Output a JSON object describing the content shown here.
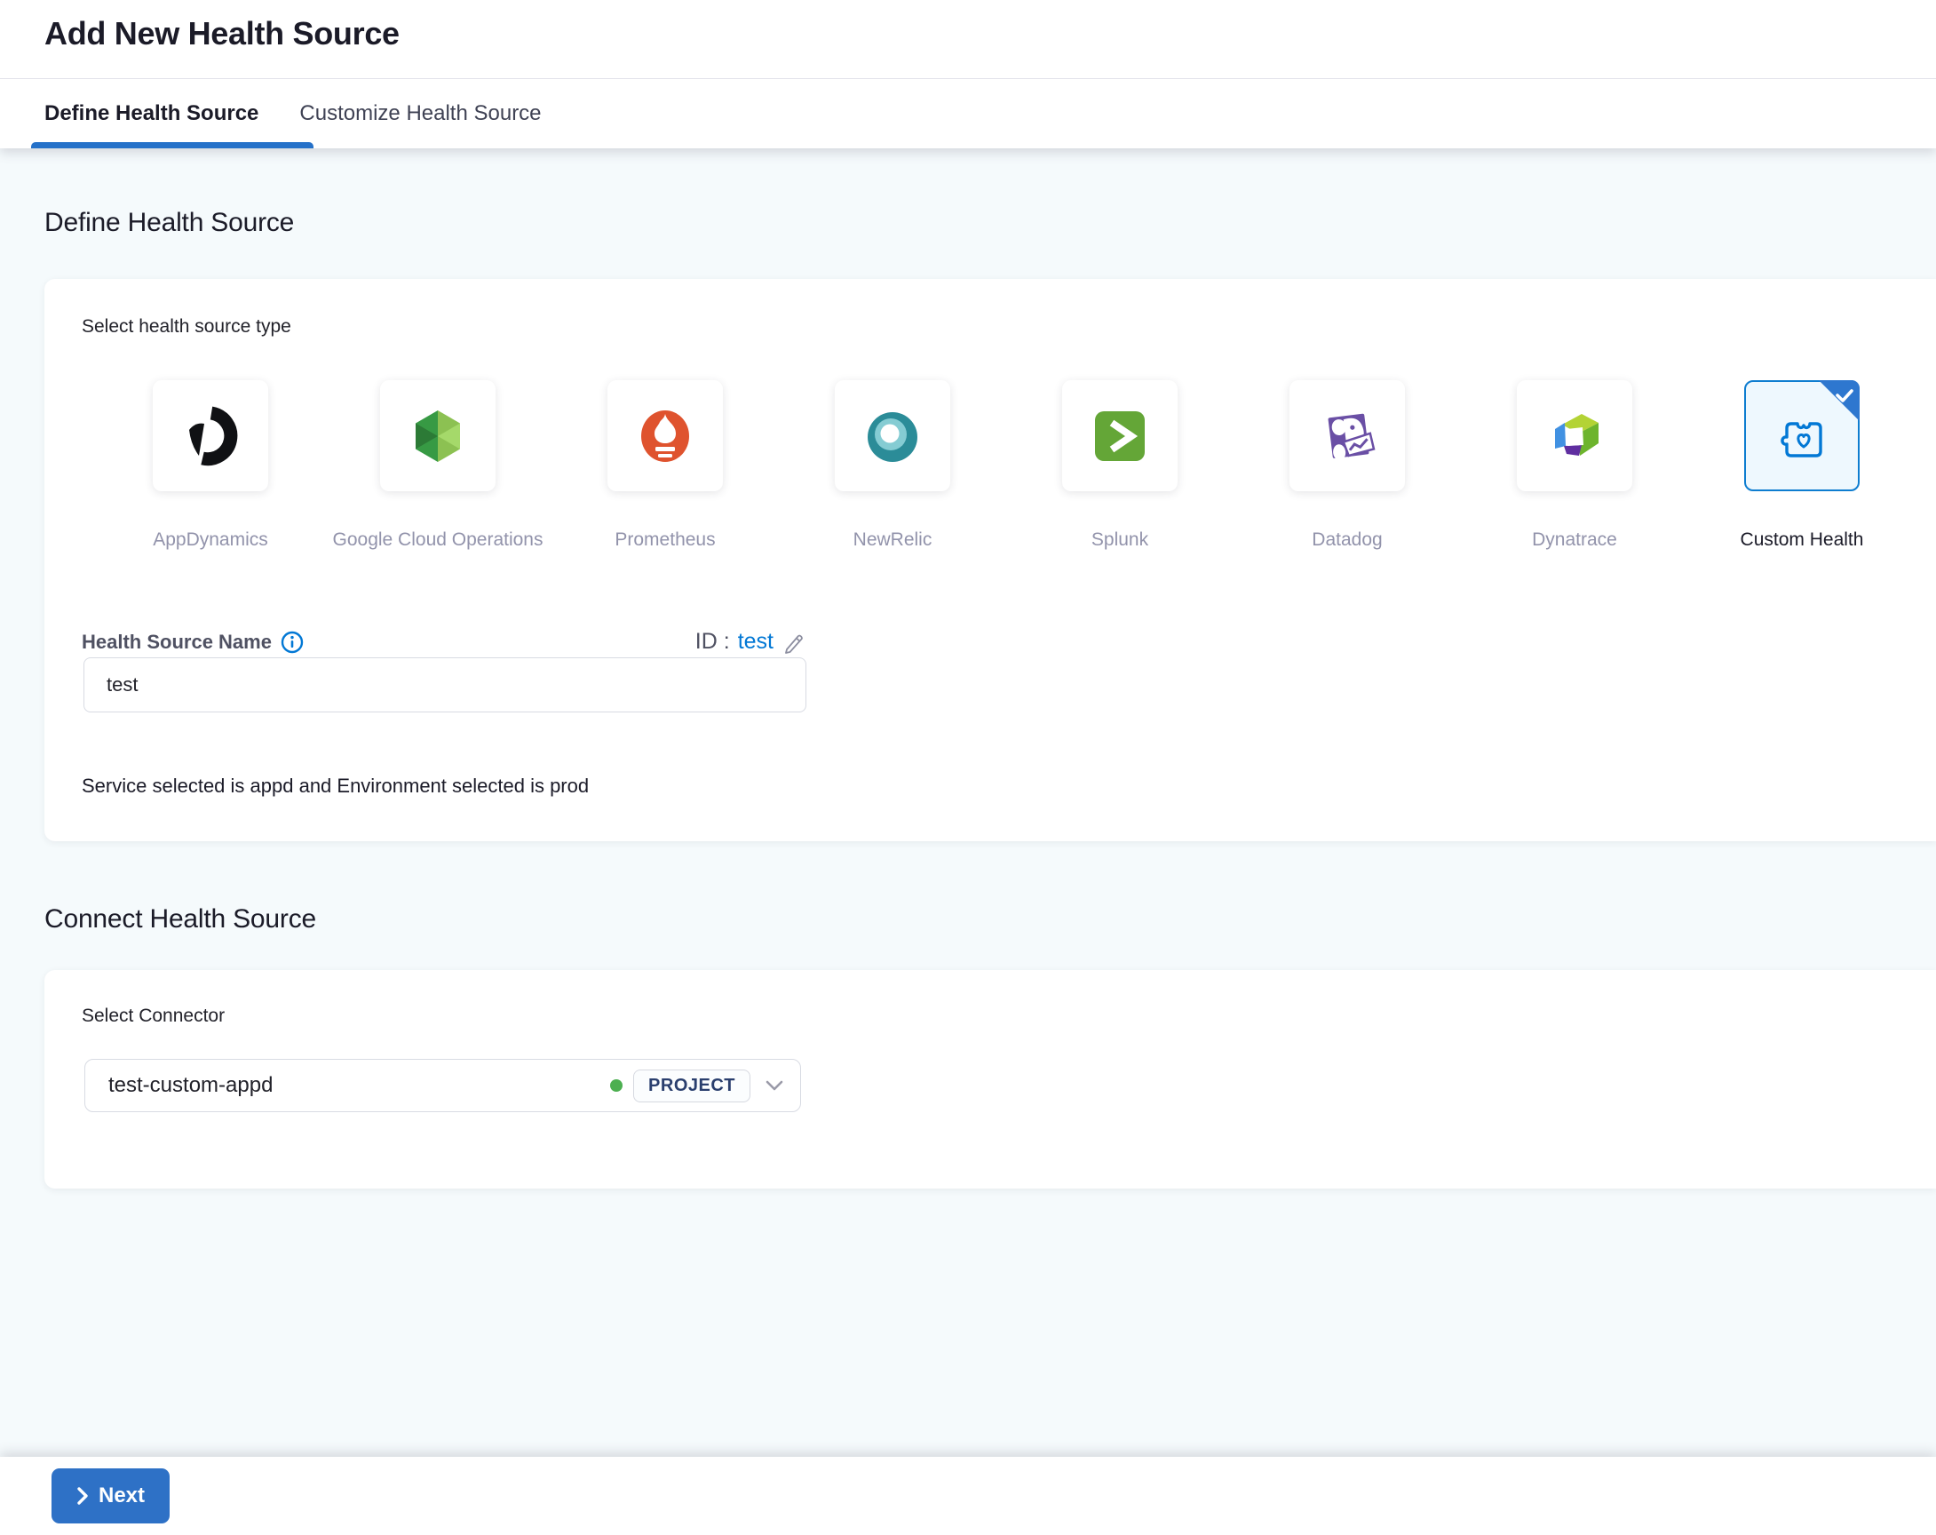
{
  "header": {
    "title": "Add New Health Source",
    "tabs": [
      {
        "label": "Define Health Source",
        "active": true
      },
      {
        "label": "Customize Health Source",
        "active": false
      }
    ]
  },
  "define": {
    "heading": "Define Health Source",
    "select_type_label": "Select health source type",
    "sources": [
      {
        "name": "AppDynamics",
        "icon": "appdynamics-icon",
        "selected": false
      },
      {
        "name": "Google Cloud Operations",
        "icon": "google-cloud-operations-icon",
        "selected": false
      },
      {
        "name": "Prometheus",
        "icon": "prometheus-icon",
        "selected": false
      },
      {
        "name": "NewRelic",
        "icon": "newrelic-icon",
        "selected": false
      },
      {
        "name": "Splunk",
        "icon": "splunk-icon",
        "selected": false
      },
      {
        "name": "Datadog",
        "icon": "datadog-icon",
        "selected": false
      },
      {
        "name": "Dynatrace",
        "icon": "dynatrace-icon",
        "selected": false
      },
      {
        "name": "Custom Health",
        "icon": "custom-health-icon",
        "selected": true
      }
    ],
    "name_field": {
      "label": "Health Source Name",
      "id_prefix": "ID :",
      "id_value": "test",
      "value": "test"
    },
    "note": "Service selected is appd and Environment selected is prod"
  },
  "connect": {
    "heading": "Connect Health Source",
    "connector_label": "Select Connector",
    "connector_value": "test-custom-appd",
    "scope_badge": "PROJECT"
  },
  "footer": {
    "next_label": "Next"
  },
  "icons": [
    "info-icon",
    "edit-pencil-icon",
    "status-dot-icon",
    "chevron-down-icon",
    "check-icon",
    "next-chevron-icon"
  ],
  "colors": {
    "accent_blue": "#0278d5",
    "tab_underline": "#2571c9",
    "next_button": "#2e71c6",
    "selected_card_bg": "#eef8fe",
    "selected_card_border": "#0e7dd0",
    "corner_check": "#2e77cf",
    "success_green": "#4caf50",
    "badge_text": "#2a3f6e",
    "muted_label": "#9293ab",
    "page_bg": "#f5fafc"
  }
}
